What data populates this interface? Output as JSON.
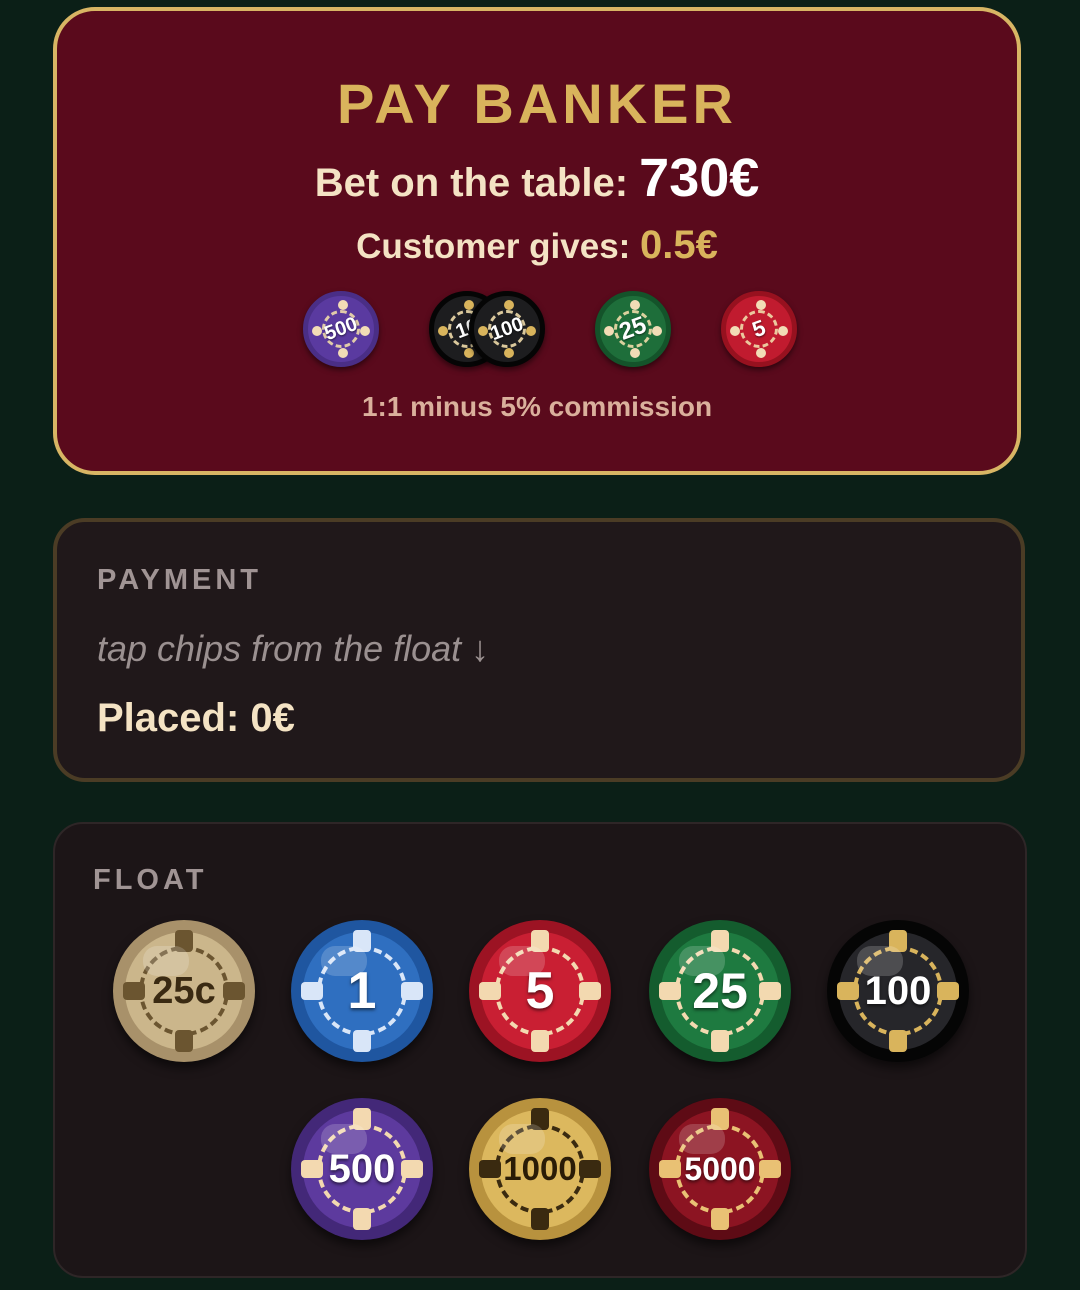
{
  "banker": {
    "title": "PAY BANKER",
    "bet_label": "Bet on the table: ",
    "bet_value": "730€",
    "gives_label": "Customer gives: ",
    "gives_value": "0.5€",
    "chips": [
      {
        "label": "500",
        "color": "#5a3aa0"
      },
      {
        "label": "10",
        "color": "#202020"
      },
      {
        "label": "100",
        "color": "#202020"
      },
      {
        "label": "25",
        "color": "#1e6e3a"
      },
      {
        "label": "5",
        "color": "#c11b2f"
      }
    ],
    "commission": "1:1 minus 5% commission"
  },
  "payment": {
    "title": "PAYMENT",
    "hint": "tap chips from the float ↓",
    "placed_label": "Placed: ",
    "placed_value": "0€"
  },
  "float": {
    "title": "FLOAT",
    "chips": [
      {
        "label": "25c",
        "color": "#c8b387",
        "accent": "#6b5530"
      },
      {
        "label": "1",
        "color": "#2f6fc0",
        "accent": "#d9e6f8"
      },
      {
        "label": "5",
        "color": "#c91f33",
        "accent": "#f3d9b0"
      },
      {
        "label": "25",
        "color": "#1e7a40",
        "accent": "#f3d9b0"
      },
      {
        "label": "100",
        "color": "#1f1f21",
        "accent": "#d9b45c"
      },
      {
        "label": "500",
        "color": "#5d3a9e",
        "accent": "#f3d9b0"
      },
      {
        "label": "1000",
        "color": "#d9b45c",
        "accent": "#3a2a10"
      },
      {
        "label": "5000",
        "color": "#8c1422",
        "accent": "#e9c174"
      }
    ]
  },
  "colors": {
    "background": "#0b1f17",
    "banker_card": "#5a0a1c",
    "gold": "#d9b45c",
    "cream": "#f4e3c4"
  }
}
